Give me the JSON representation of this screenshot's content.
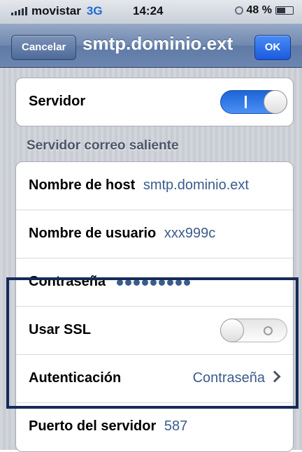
{
  "status_bar": {
    "carrier": "movistar",
    "network": "3G",
    "time": "14:24",
    "battery": "48 %",
    "battery_level": 0.48
  },
  "navbar": {
    "cancel_label": "Cancelar",
    "title": "smtp.dominio.ext",
    "ok_label": "OK"
  },
  "server_toggle": {
    "label": "Servidor",
    "state": "on"
  },
  "outgoing_section": {
    "header": "Servidor correo saliente",
    "host_label": "Nombre de host",
    "host_value": "smtp.dominio.ext",
    "user_label": "Nombre de usuario",
    "user_value": "xxx999c",
    "password_label": "Contraseña",
    "password_mask_count": 9
  },
  "security_section": {
    "ssl_label": "Usar SSL",
    "ssl_state": "off",
    "auth_label": "Autenticación",
    "auth_value": "Contraseña",
    "port_label": "Puerto del servidor",
    "port_value": "587"
  },
  "colors": {
    "value_text": "#3b5b8c",
    "highlight_border": "#152a58",
    "toggle_on": "#1e64d6"
  }
}
